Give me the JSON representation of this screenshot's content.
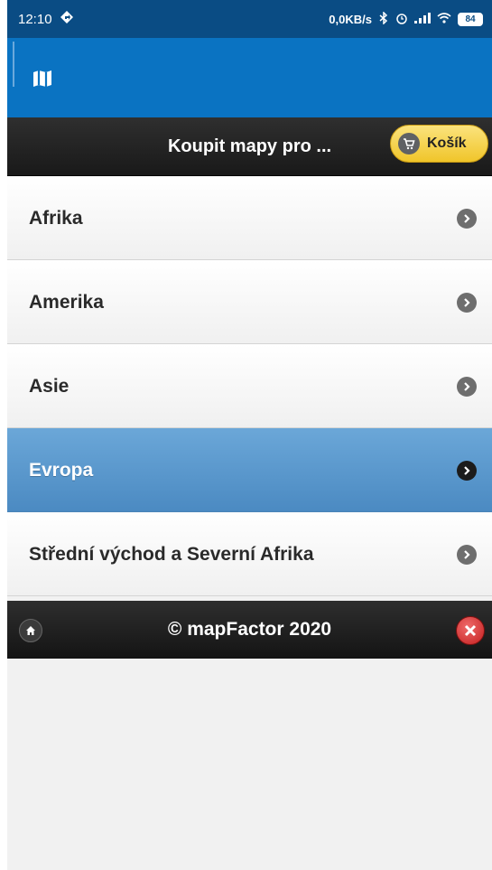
{
  "status_bar": {
    "time": "12:10",
    "network_speed": "0,0KB/s",
    "battery": "84",
    "icons": [
      "navigation-icon",
      "bluetooth-icon",
      "alarm-icon",
      "signal-icon",
      "wifi-icon",
      "battery-icon"
    ]
  },
  "app_bar": {
    "icon": "map-icon"
  },
  "header": {
    "title": "Koupit mapy pro ...",
    "cart_label": "Košík"
  },
  "regions": [
    {
      "label": "Afrika",
      "active": false
    },
    {
      "label": "Amerika",
      "active": false
    },
    {
      "label": "Asie",
      "active": false
    },
    {
      "label": "Evropa",
      "active": true
    },
    {
      "label": "Střední východ a Severní Afrika",
      "active": false
    }
  ],
  "footer": {
    "text": "© mapFactor 2020"
  },
  "colors": {
    "status_bar": "#0a4c84",
    "app_bar": "#0a73c2",
    "active_item": "#5b99cf",
    "cart_button": "#f3cc3a",
    "close_button": "#d62c2c"
  }
}
